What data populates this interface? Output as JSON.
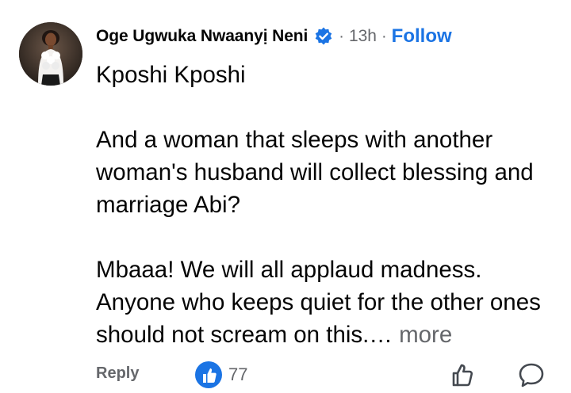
{
  "comment": {
    "author_name": "Oge Ugwuka Nwaanyị Neni",
    "verified_icon": "verified-badge-icon",
    "separator": "·",
    "time": "13h",
    "follow_label": "Follow",
    "lines": [
      "Kposhi Kposhi",
      "And a woman that sleeps with another woman's husband will collect blessing and marriage Abi?",
      "Mbaaa! We will all applaud madness. Anyone who keeps quiet for the other ones should not scream on this.…"
    ],
    "more_label": "more"
  },
  "actions": {
    "reply_label": "Reply",
    "like_count": "77",
    "like_icon": "thumbs-up-icon",
    "react_icon": "thumbs-up-outline-icon",
    "comment_icon": "speech-bubble-icon"
  },
  "colors": {
    "text": "#050505",
    "secondary": "#65676b",
    "accent": "#1b74e4"
  }
}
